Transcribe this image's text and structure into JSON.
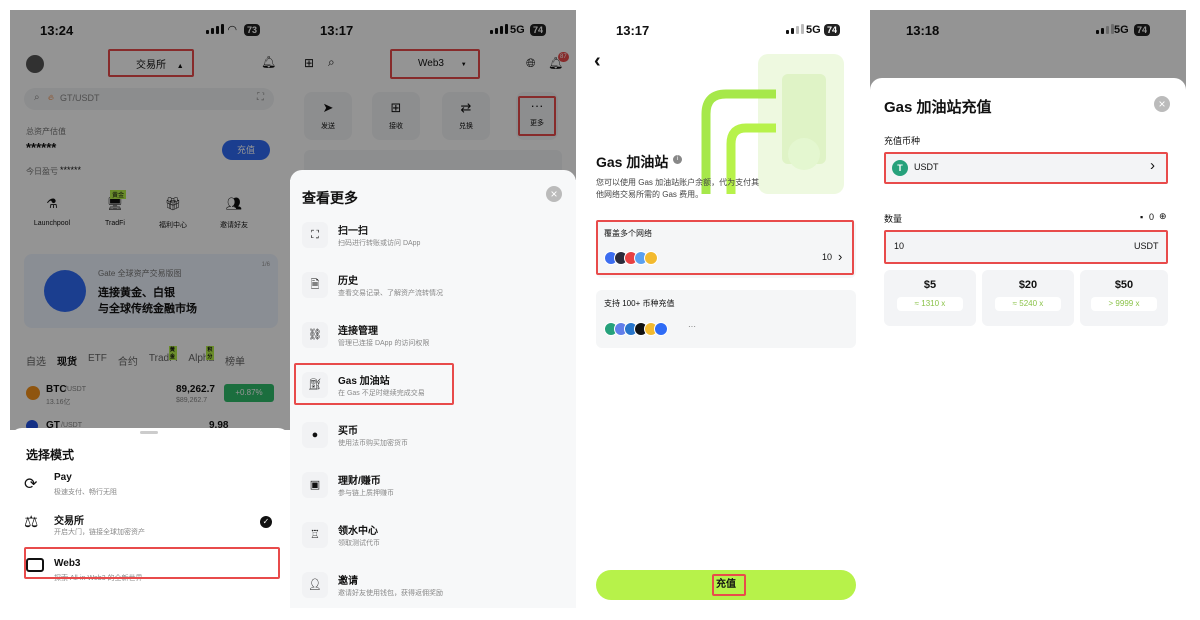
{
  "colors": {
    "accent_green": "#b7f24a",
    "highlight_red": "#e84b4b",
    "blue_button": "#2f6cf6",
    "up_green": "#2fbd6c"
  },
  "screen1": {
    "status": {
      "time": "13:24",
      "battery": "73"
    },
    "header": {
      "exchange_label": "交易所",
      "exchange_arrow": "▲"
    },
    "search": {
      "placeholder": "GT/USDT"
    },
    "assets": {
      "label": "总资产估值",
      "value": "******",
      "deposit_button": "充值",
      "pnl_label": "今日盈亏",
      "pnl_value": "******"
    },
    "shortcuts": [
      {
        "label": "Launchpool",
        "icon": "launchpool-icon"
      },
      {
        "label": "TradFi",
        "badge": "黄金",
        "icon": "tradfi-icon"
      },
      {
        "label": "福利中心",
        "icon": "gift-icon"
      },
      {
        "label": "邀请好友",
        "icon": "invite-icon"
      }
    ],
    "banner": {
      "title_small": "Gate 全球资产交易版图",
      "line1": "连接黄金、白银",
      "line2": "与全球传统金融市场",
      "page": "1/6"
    },
    "market_tabs": [
      {
        "label": "自选"
      },
      {
        "label": "现货"
      },
      {
        "label": "ETF"
      },
      {
        "label": "合约"
      },
      {
        "label": "TradFi",
        "badge": "黄金"
      },
      {
        "label": "Alpha",
        "badge": "积分"
      },
      {
        "label": "榜单"
      }
    ],
    "rows": [
      {
        "pair": "BTC",
        "quote": "/USDT",
        "volume": "13.16亿",
        "price": "89,262.7",
        "price_sub": "$89,262.7",
        "change": "+0.87%"
      },
      {
        "pair": "GT",
        "quote": "/USDT",
        "price": "9.98"
      }
    ],
    "mode_sheet": {
      "title": "选择模式",
      "items": [
        {
          "name": "Pay",
          "desc": "极速支付、畅行无阻",
          "icon": "pay-icon"
        },
        {
          "name": "交易所",
          "desc": "开启大门，链接全球加密资产",
          "icon": "candlestick-icon",
          "checked": true
        },
        {
          "name": "Web3",
          "desc": "探索 All-in Web3 的全新世界",
          "icon": "wallet-icon"
        }
      ],
      "check": "✓"
    }
  },
  "screen2": {
    "status": {
      "time": "13:17",
      "net": "5G",
      "battery": "74"
    },
    "header": {
      "title": "Web3",
      "arrow": "▼",
      "notif_count": "87"
    },
    "actions": [
      {
        "label": "发送",
        "icon": "send-icon"
      },
      {
        "label": "接收",
        "icon": "receive-icon"
      },
      {
        "label": "兑换",
        "icon": "swap-icon"
      },
      {
        "label": "更多",
        "icon": "more-icon"
      }
    ],
    "sheet": {
      "title": "查看更多",
      "close": "×",
      "items": [
        {
          "title": "扫一扫",
          "desc": "扫码进行转账或访问 DApp",
          "icon": "scan-icon"
        },
        {
          "title": "历史",
          "desc": "查看交易记录、了解资产流转情况",
          "icon": "history-icon"
        },
        {
          "title": "连接管理",
          "desc": "管理已连接 DApp 的访问权限",
          "icon": "link-icon"
        },
        {
          "title": "Gas 加油站",
          "desc": "在 Gas 不足时继续完成交易",
          "icon": "gas-pump-icon"
        },
        {
          "title": "买币",
          "desc": "使用法币购买加密货币",
          "icon": "buy-coin-icon"
        },
        {
          "title": "理财/赚币",
          "desc": "参与链上质押赚币",
          "icon": "earn-icon"
        },
        {
          "title": "领水中心",
          "desc": "领取测试代币",
          "icon": "faucet-icon"
        },
        {
          "title": "邀请",
          "desc": "邀请好友使用钱包，获得返佣奖励",
          "icon": "invite-add-icon"
        }
      ]
    }
  },
  "screen3": {
    "status": {
      "time": "13:17",
      "net": "5G",
      "battery": "74"
    },
    "back": "‹",
    "title": "Gas 加油站",
    "info": "i",
    "desc_line1": "您可以使用 Gas 加油站账户余额，代为支付其",
    "desc_line2": "他网络交易所需的 Gas 费用。",
    "networks": {
      "label": "覆盖多个网络",
      "count": "10",
      "arrow": "›"
    },
    "coins_support": {
      "label": "支持 100+ 币种充值",
      "more": "···"
    },
    "cta": "充值"
  },
  "screen4": {
    "status": {
      "time": "13:18",
      "net": "5G",
      "battery": "74"
    },
    "title": "Gas 加油站充值",
    "close": "×",
    "coin_label": "充值币种",
    "coin_value": "USDT",
    "coin_arrow": "›",
    "amount_label": "数量",
    "balance": "0",
    "amount_value": "10",
    "amount_unit": "USDT",
    "presets": [
      {
        "amount": "$5",
        "est": "≈ 1310 x"
      },
      {
        "amount": "$20",
        "est": "≈ 5240 x"
      },
      {
        "amount": "$50",
        "est": "> 9999 x"
      }
    ]
  }
}
